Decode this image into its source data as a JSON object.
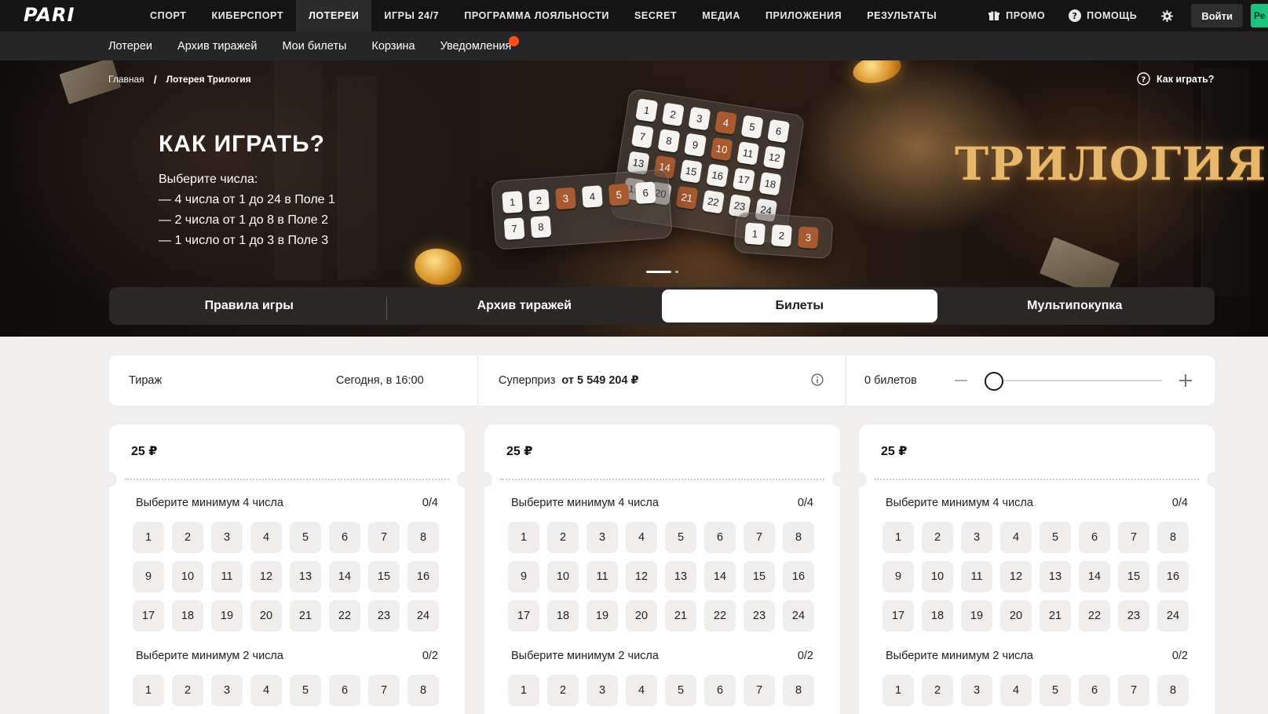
{
  "brand": {
    "logo": "PARI"
  },
  "topnav": {
    "items": [
      "Спорт",
      "Киберспорт",
      "Лотереи",
      "Игры 24/7",
      "Программа лояльности",
      "Secret",
      "Медиа",
      "Приложения",
      "Результаты"
    ],
    "active_index": 2,
    "promo": "ПРОМО",
    "help": "ПОМОЩЬ",
    "login": "Войти",
    "register_partial": "Ре"
  },
  "subnav": {
    "items": [
      "Лотереи",
      "Архив тиражей",
      "Мои билеты",
      "Корзина",
      "Уведомления"
    ]
  },
  "hero": {
    "breadcrumb": {
      "home": "Главная",
      "sep": "/",
      "current": "Лотерея Трилогия"
    },
    "howto_link": "Как играть?",
    "title": "КАК ИГРАТЬ?",
    "lines": [
      "Выберите числа:",
      "— 4 числа от 1 до 24 в Поле 1",
      "— 2 числа от 1 до 8 в Поле 2",
      "— 1 число от 1 до 3 в Поле 3"
    ],
    "logo_text": "ТРИЛОГИЯ",
    "illustration": {
      "card_big": [
        "1",
        "2",
        "3",
        "4",
        "5",
        "6",
        "7",
        "8",
        "9",
        "10",
        "11",
        "12",
        "13",
        "14",
        "15",
        "16",
        "17",
        "18",
        "19",
        "20",
        "21",
        "22",
        "23",
        "24"
      ],
      "card_big_hot": [
        "4",
        "10",
        "14",
        "21"
      ],
      "card_mid": [
        "1",
        "2",
        "3",
        "4",
        "5",
        "6",
        "7",
        "8"
      ],
      "card_mid_hot": [
        "3",
        "5"
      ],
      "card_small": [
        "1",
        "2",
        "3"
      ],
      "card_small_hot": [
        "3"
      ]
    }
  },
  "tabs": [
    "Правила игры",
    "Архив тиражей",
    "Билеты",
    "Мультипокупка"
  ],
  "active_tab": 2,
  "draw": {
    "label": "Тираж",
    "time": "Сегодня, в 16:00",
    "prize_label": "Суперприз",
    "prize_value": "от 5 549 204 ₽",
    "tickets_count": "0 билетов",
    "slider_value": 0
  },
  "tickets": [
    {
      "price": "25 ₽",
      "field1_label": "Выберите минимум 4 числа",
      "field1_count": "0/4",
      "field2_label": "Выберите минимум 2 числа",
      "field2_count": "0/2"
    },
    {
      "price": "25 ₽",
      "field1_label": "Выберите минимум 4 числа",
      "field1_count": "0/4",
      "field2_label": "Выберите минимум 2 числа",
      "field2_count": "0/2"
    },
    {
      "price": "25 ₽",
      "field1_label": "Выберите минимум 4 числа",
      "field1_count": "0/4",
      "field2_label": "Выберите минимум 2 числа",
      "field2_count": "0/2"
    }
  ],
  "field1_numbers": [
    "1",
    "2",
    "3",
    "4",
    "5",
    "6",
    "7",
    "8",
    "9",
    "10",
    "11",
    "12",
    "13",
    "14",
    "15",
    "16",
    "17",
    "18",
    "19",
    "20",
    "21",
    "22",
    "23",
    "24"
  ],
  "field2_numbers": [
    "1",
    "2",
    "3",
    "4",
    "5",
    "6",
    "7",
    "8"
  ],
  "colors": {
    "accent": "#19c37d",
    "hot_cell": "#a95a2e",
    "notify": "#ff4d1a",
    "dark": "#141414"
  }
}
